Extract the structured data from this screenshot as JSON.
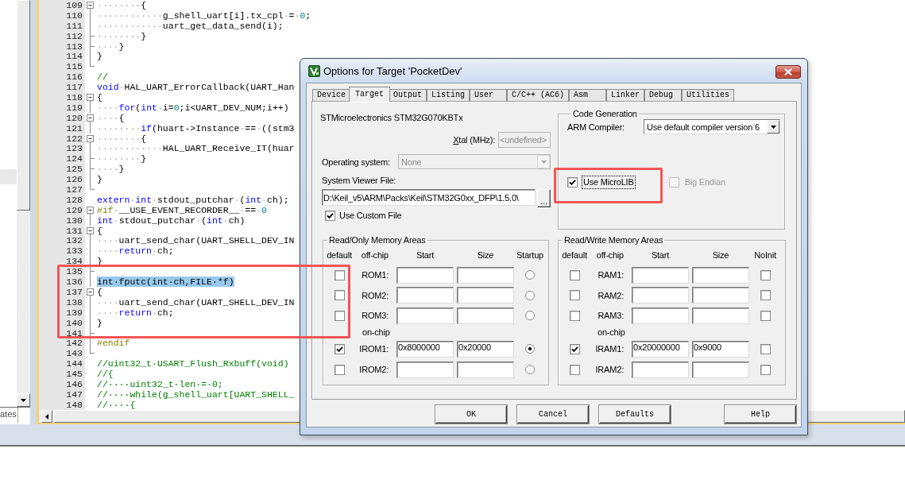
{
  "side_panel": {
    "highlighted_row": true,
    "tab": "ates"
  },
  "editor": {
    "sections": [
      {
        "outlined": false,
        "lines": [
          {
            "number": "109",
            "fold": {
              "kind": "box"
            },
            "selected": false,
            "segments": [
              {
                "kind": "space",
                "text": "········"
              },
              {
                "kind": "plain",
                "text": "{"
              }
            ]
          },
          {
            "number": "110",
            "fold": {
              "kind": "line"
            },
            "selected": false,
            "segments": [
              {
                "kind": "space",
                "text": "············"
              },
              {
                "kind": "plain",
                "text": "g_shell_uart[i].tx_cpl"
              },
              {
                "kind": "space",
                "text": "·"
              },
              {
                "kind": "plain",
                "text": "="
              },
              {
                "kind": "space",
                "text": "·"
              },
              {
                "kind": "number",
                "text": "0"
              },
              {
                "kind": "plain",
                "text": ";"
              }
            ]
          },
          {
            "number": "111",
            "fold": {
              "kind": "line"
            },
            "selected": false,
            "segments": [
              {
                "kind": "space",
                "text": "············"
              },
              {
                "kind": "plain",
                "text": "uart_get_data_send(i);"
              }
            ]
          },
          {
            "number": "112",
            "fold": {
              "kind": "tick"
            },
            "selected": false,
            "segments": [
              {
                "kind": "space",
                "text": "········"
              },
              {
                "kind": "plain",
                "text": "}"
              }
            ]
          },
          {
            "number": "113",
            "fold": {
              "kind": "tick"
            },
            "selected": false,
            "segments": [
              {
                "kind": "space",
                "text": "····"
              },
              {
                "kind": "plain",
                "text": "}"
              }
            ]
          },
          {
            "number": "114",
            "fold": {
              "kind": "line"
            },
            "selected": false,
            "segments": [
              {
                "kind": "plain",
                "text": "}"
              }
            ]
          },
          {
            "number": "115",
            "fold": {
              "kind": "end"
            },
            "selected": false
          },
          {
            "number": "116",
            "selected": false,
            "segments": [
              {
                "kind": "comment",
                "text": "//"
              }
            ]
          },
          {
            "number": "117",
            "selected": false,
            "segments": [
              {
                "kind": "keyword",
                "text": "void"
              },
              {
                "kind": "space",
                "text": "·"
              },
              {
                "kind": "plain",
                "text": "HAL_UART_ErrorCallback(UART_Han"
              }
            ]
          },
          {
            "number": "118",
            "fold": {
              "kind": "box"
            },
            "selected": false,
            "segments": [
              {
                "kind": "plain",
                "text": "{"
              }
            ]
          },
          {
            "number": "119",
            "fold": {
              "kind": "line"
            },
            "selected": false,
            "segments": [
              {
                "kind": "space",
                "text": "····"
              },
              {
                "kind": "keyword",
                "text": "for"
              },
              {
                "kind": "plain",
                "text": "("
              },
              {
                "kind": "keyword",
                "text": "int"
              },
              {
                "kind": "space",
                "text": "·"
              },
              {
                "kind": "plain",
                "text": "i="
              },
              {
                "kind": "number",
                "text": "0"
              },
              {
                "kind": "plain",
                "text": ";i<UART_DEV_NUM;i++)"
              }
            ]
          },
          {
            "number": "120",
            "fold": {
              "kind": "box"
            },
            "selected": false,
            "segments": [
              {
                "kind": "space",
                "text": "····"
              },
              {
                "kind": "plain",
                "text": "{"
              }
            ]
          },
          {
            "number": "121",
            "fold": {
              "kind": "line"
            },
            "selected": false,
            "segments": [
              {
                "kind": "space",
                "text": "········"
              },
              {
                "kind": "keyword",
                "text": "if"
              },
              {
                "kind": "plain",
                "text": "(huart->Instance"
              },
              {
                "kind": "space",
                "text": "·"
              },
              {
                "kind": "plain",
                "text": "=="
              },
              {
                "kind": "space",
                "text": "·"
              },
              {
                "kind": "plain",
                "text": "((stm3"
              }
            ]
          },
          {
            "number": "122",
            "fold": {
              "kind": "box"
            },
            "selected": false,
            "segments": [
              {
                "kind": "space",
                "text": "········"
              },
              {
                "kind": "plain",
                "text": "{"
              }
            ]
          },
          {
            "number": "123",
            "fold": {
              "kind": "line"
            },
            "selected": false,
            "segments": [
              {
                "kind": "space",
                "text": "············"
              },
              {
                "kind": "plain",
                "text": "HAL_UART_Receive_IT(huar"
              }
            ]
          },
          {
            "number": "124",
            "fold": {
              "kind": "tick"
            },
            "selected": false,
            "segments": [
              {
                "kind": "space",
                "text": "········"
              },
              {
                "kind": "plain",
                "text": "}"
              }
            ]
          },
          {
            "number": "125",
            "fold": {
              "kind": "tick"
            },
            "selected": false,
            "segments": [
              {
                "kind": "space",
                "text": "····"
              },
              {
                "kind": "plain",
                "text": "}"
              }
            ]
          },
          {
            "number": "126",
            "fold": {
              "kind": "line"
            },
            "selected": false,
            "segments": [
              {
                "kind": "plain",
                "text": "}"
              }
            ]
          },
          {
            "number": "127",
            "fold": {
              "kind": "end"
            },
            "selected": false
          },
          {
            "number": "128",
            "selected": false,
            "segments": [
              {
                "kind": "keyword",
                "text": "extern"
              },
              {
                "kind": "space",
                "text": "·"
              },
              {
                "kind": "keyword",
                "text": "int"
              },
              {
                "kind": "space",
                "text": "·"
              },
              {
                "kind": "plain",
                "text": "stdout_putchar"
              },
              {
                "kind": "space",
                "text": "·"
              },
              {
                "kind": "plain",
                "text": "("
              },
              {
                "kind": "keyword",
                "text": "int"
              },
              {
                "kind": "space",
                "text": "·"
              },
              {
                "kind": "plain",
                "text": "ch);"
              }
            ]
          },
          {
            "number": "129",
            "fold": {
              "kind": "box"
            },
            "selected": false,
            "segments": [
              {
                "kind": "preproc",
                "text": "#if"
              },
              {
                "kind": "space",
                "text": "·"
              },
              {
                "kind": "plain",
                "text": "__USE_EVENT_RECORDER__"
              },
              {
                "kind": "space",
                "text": "·"
              },
              {
                "kind": "plain",
                "text": "=="
              },
              {
                "kind": "space",
                "text": "·"
              },
              {
                "kind": "number",
                "text": "0"
              }
            ]
          },
          {
            "number": "130",
            "fold": {
              "kind": "line"
            },
            "selected": false,
            "segments": [
              {
                "kind": "keyword",
                "text": "int"
              },
              {
                "kind": "space",
                "text": "·"
              },
              {
                "kind": "plain",
                "text": "stdout_putchar"
              },
              {
                "kind": "space",
                "text": "·"
              },
              {
                "kind": "plain",
                "text": "("
              },
              {
                "kind": "keyword",
                "text": "int"
              },
              {
                "kind": "space",
                "text": "·"
              },
              {
                "kind": "plain",
                "text": "ch)"
              }
            ]
          },
          {
            "number": "131",
            "fold": {
              "kind": "box"
            },
            "selected": false,
            "segments": [
              {
                "kind": "plain",
                "text": "{"
              }
            ]
          },
          {
            "number": "132",
            "fold": {
              "kind": "line"
            },
            "selected": false,
            "segments": [
              {
                "kind": "space",
                "text": "····"
              },
              {
                "kind": "plain",
                "text": "uart_send_char(UART_SHELL_DEV_IN"
              }
            ]
          },
          {
            "number": "133",
            "fold": {
              "kind": "line"
            },
            "selected": false,
            "segments": [
              {
                "kind": "space",
                "text": "····"
              },
              {
                "kind": "keyword",
                "text": "return"
              },
              {
                "kind": "space",
                "text": "·"
              },
              {
                "kind": "plain",
                "text": "ch;"
              }
            ]
          },
          {
            "number": "134",
            "fold": {
              "kind": "line"
            },
            "selected": false,
            "segments": [
              {
                "kind": "plain",
                "text": "}"
              }
            ]
          }
        ]
      },
      {
        "outlined": true,
        "lines": [
          {
            "number": "135",
            "fold": {
              "kind": "tick"
            },
            "selected": false
          },
          {
            "number": "136",
            "fold": {
              "kind": "line"
            },
            "selected": true,
            "segments": [
              {
                "kind": "plain",
                "text": "int·fputc(int·ch,FILE·*f)"
              }
            ]
          },
          {
            "number": "137",
            "fold": {
              "kind": "box"
            },
            "selected": false,
            "segments": [
              {
                "kind": "plain",
                "text": "{"
              }
            ]
          },
          {
            "number": "138",
            "fold": {
              "kind": "line"
            },
            "selected": false,
            "segments": [
              {
                "kind": "space",
                "text": "····"
              },
              {
                "kind": "plain",
                "text": "uart_send_char(UART_SHELL_DEV_IN"
              }
            ]
          },
          {
            "number": "139",
            "fold": {
              "kind": "line"
            },
            "selected": false,
            "segments": [
              {
                "kind": "space",
                "text": "····"
              },
              {
                "kind": "keyword",
                "text": "return"
              },
              {
                "kind": "space",
                "text": "·"
              },
              {
                "kind": "plain",
                "text": "ch;"
              }
            ]
          },
          {
            "number": "140",
            "fold": {
              "kind": "line"
            },
            "selected": false,
            "segments": [
              {
                "kind": "plain",
                "text": "}"
              }
            ]
          },
          {
            "number": "141",
            "fold": {
              "kind": "tick"
            },
            "selected": false
          }
        ]
      },
      {
        "outlined": false,
        "lines": [
          {
            "number": "142",
            "fold": {
              "kind": "line"
            },
            "selected": false,
            "segments": [
              {
                "kind": "preproc",
                "text": "#endif"
              }
            ]
          },
          {
            "number": "143",
            "fold": {
              "kind": "end"
            },
            "selected": false
          },
          {
            "number": "144",
            "selected": false,
            "segments": [
              {
                "kind": "comment",
                "text": "//uint32_t·USART_Flush_Rxbuff(void)"
              }
            ]
          },
          {
            "number": "145",
            "selected": false,
            "segments": [
              {
                "kind": "comment",
                "text": "//{"
              }
            ]
          },
          {
            "number": "146",
            "selected": false,
            "segments": [
              {
                "kind": "comment",
                "text": "//····uint32_t·len·=·0;"
              }
            ]
          },
          {
            "number": "147",
            "selected": false,
            "segments": [
              {
                "kind": "comment",
                "text": "//····while(g_shell_uart[UART_SHELL_"
              }
            ]
          },
          {
            "number": "148",
            "selected": false,
            "segments": [
              {
                "kind": "comment",
                "text": "//····{"
              }
            ]
          }
        ]
      }
    ]
  },
  "dialog": {
    "title": "Options for Target 'PocketDev'",
    "tabs": [
      {
        "label": "Device",
        "selected": false
      },
      {
        "label": "Target",
        "selected": true
      },
      {
        "label": "Output",
        "selected": false
      },
      {
        "label": "Listing",
        "selected": false
      },
      {
        "label": "User",
        "selected": false
      },
      {
        "label": "C/C++ (AC6)",
        "selected": false
      },
      {
        "label": "Asm",
        "selected": false
      },
      {
        "label": "Linker",
        "selected": false
      },
      {
        "label": "Debug",
        "selected": false
      },
      {
        "label": "Utilities",
        "selected": false
      }
    ],
    "device": "STMicroelectronics STM32G070KBTx",
    "xtal": {
      "label": "Xtal (MHz):",
      "mnemonic": true,
      "value": "<undefined>",
      "disabled": true
    },
    "operating_system": {
      "label": "Operating system:",
      "value": "None",
      "disabled": true
    },
    "system_viewer_file": {
      "label": "System Viewer File:",
      "value": "D:\\Keil_v5\\ARM\\Packs\\Keil\\STM32G0xx_DFP\\1.5.0\\",
      "browse": "..."
    },
    "use_custom_file": {
      "label": "Use Custom File",
      "checked": true
    },
    "code_generation": {
      "title": "Code Generation",
      "compiler_label": "ARM Compiler:",
      "compiler": "Use default compiler version 6",
      "options": [
        {
          "label": "Use MicroLIB",
          "checked": true,
          "disabled": false,
          "focused": true,
          "outlined": true
        },
        {
          "label": "Big Endian",
          "checked": false,
          "disabled": true,
          "focused": false,
          "outlined": false
        }
      ]
    },
    "read_only_memory": {
      "title": "Read/Only Memory Areas",
      "columns": [
        "default",
        "off-chip",
        "Start",
        "Size",
        "Startup"
      ],
      "rows": [
        {
          "kind": "area",
          "label": "ROM1:",
          "checked": false,
          "selected": false
        },
        {
          "kind": "area",
          "label": "ROM2:",
          "checked": false,
          "selected": false
        },
        {
          "kind": "area",
          "label": "ROM3:",
          "checked": false,
          "selected": false
        },
        {
          "kind": "heading",
          "label": "on-chip"
        },
        {
          "kind": "area",
          "label": "IROM1:",
          "checked": true,
          "start": "0x8000000",
          "size": "0x20000",
          "selected": true
        },
        {
          "kind": "area",
          "label": "IROM2:",
          "checked": false,
          "selected": false
        }
      ]
    },
    "read_write_memory": {
      "title": "Read/Write Memory Areas",
      "columns": [
        "default",
        "off-chip",
        "Start",
        "Size",
        "NoInit"
      ],
      "rows": [
        {
          "kind": "area",
          "label": "RAM1:",
          "checked": false,
          "noinit": false
        },
        {
          "kind": "area",
          "label": "RAM2:",
          "checked": false,
          "noinit": false
        },
        {
          "kind": "area",
          "label": "RAM3:",
          "checked": false,
          "noinit": false
        },
        {
          "kind": "heading",
          "label": "on-chip"
        },
        {
          "kind": "area",
          "label": "IRAM1:",
          "checked": true,
          "start": "0x20000000",
          "size": "0x9000",
          "noinit": false
        },
        {
          "kind": "area",
          "label": "IRAM2:",
          "checked": false,
          "noinit": false
        }
      ]
    },
    "buttons": [
      "OK",
      "Cancel",
      "Defaults",
      "Help"
    ]
  }
}
